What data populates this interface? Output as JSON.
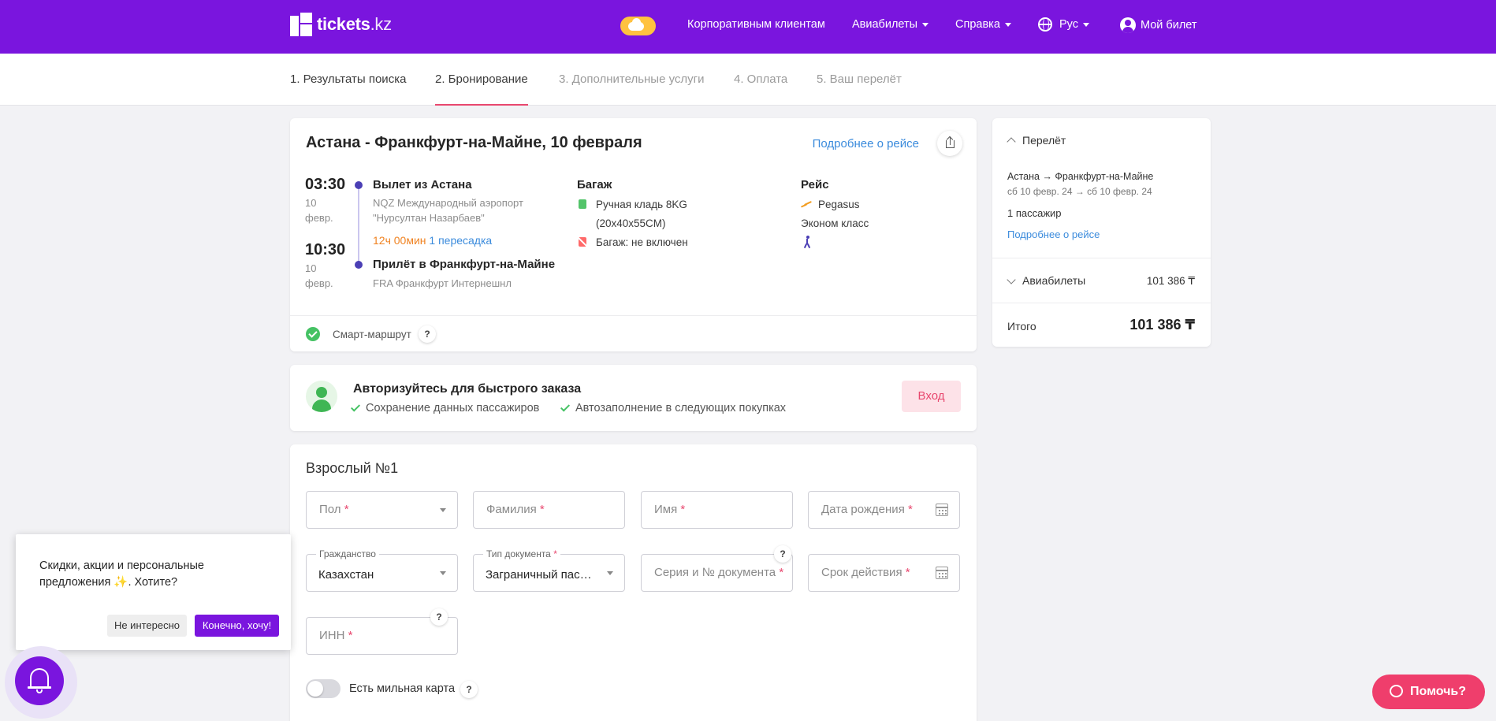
{
  "header": {
    "logo_text": "tickets",
    "logo_suffix": ".kz",
    "nav": {
      "corporate": "Корпоративным клиентам",
      "flights": "Авиабилеты",
      "help": "Справка",
      "language": "Рус",
      "my_ticket": "Мой билет"
    },
    "icons": [
      "weather-icon",
      "globe-icon",
      "user-icon"
    ]
  },
  "steps": [
    {
      "label": "1. Результаты поиска",
      "state": "done"
    },
    {
      "label": "2. Бронирование",
      "state": "active"
    },
    {
      "label": "3. Дополнительные услуги",
      "state": "pending"
    },
    {
      "label": "4. Оплата",
      "state": "pending"
    },
    {
      "label": "5. Ваш перелёт",
      "state": "pending"
    }
  ],
  "flight": {
    "title": "Астана - Франкфурт-на-Майне, 10 февраля",
    "details_link": "Подробнее о рейсе",
    "departure": {
      "time": "03:30",
      "date": "10 февр.",
      "title": "Вылет из Астана",
      "airport": "NQZ Международный аэропорт \"Нурсултан Назарбаев\""
    },
    "duration": "12ч 00мин",
    "stops": "1 пересадка",
    "arrival": {
      "time": "10:30",
      "date": "10 февр.",
      "title": "Прилёт в Франкфурт-на-Майне",
      "airport": "FRA Франкфурт Интернешнл"
    },
    "baggage": {
      "title": "Багаж",
      "hand": "Ручная кладь 8KG",
      "hand_size": "(20x40x55CM)",
      "checked": "Багаж: не включен"
    },
    "carrier": {
      "title": "Рейс",
      "airline": "Pegasus",
      "class": "Эконом класс"
    },
    "smart_route": "Смарт-маршрут",
    "question_mark": "?"
  },
  "login": {
    "title": "Авторизуйтесь для быстрого заказа",
    "perks": [
      "Сохранение данных пассажиров",
      "Автозаполнение в следующих покупках"
    ],
    "button": "Вход"
  },
  "passenger": {
    "title": "Взрослый №1",
    "required_mark": "*",
    "fields": {
      "gender": "Пол",
      "surname": "Фамилия",
      "name": "Имя",
      "birthdate": "Дата рождения",
      "citizenship_label": "Гражданство",
      "citizenship_value": "Казахстан",
      "doc_type_label": "Тип документа",
      "doc_type_value": "Заграничный паспорт",
      "doc_number": "Серия и № документа",
      "expiry": "Срок действия",
      "iin": "ИНН"
    },
    "mile_card": "Есть мильная карта"
  },
  "sidebar": {
    "flight_section": "Перелёт",
    "route": "Астана → Франкфурт-на-Майне",
    "dates": "сб 10 февр. 24 → сб 10 февр. 24",
    "passengers": "1 пассажир",
    "details_link": "Подробнее о рейсе",
    "tickets_label": "Авиабилеты",
    "tickets_price": "101 386 ₸",
    "total_label": "Итого",
    "total_price": "101 386 ₸"
  },
  "promo": {
    "text": "Скидки, акции и персональные предложения ✨. Хотите?",
    "no": "Не интересно",
    "yes": "Конечно, хочу!"
  },
  "help_button": "Помочь?",
  "colors": {
    "brand": "#7a15de",
    "accent": "#e8476e",
    "link": "#3b8bdc",
    "duration": "#f08322",
    "success": "#45c264"
  }
}
